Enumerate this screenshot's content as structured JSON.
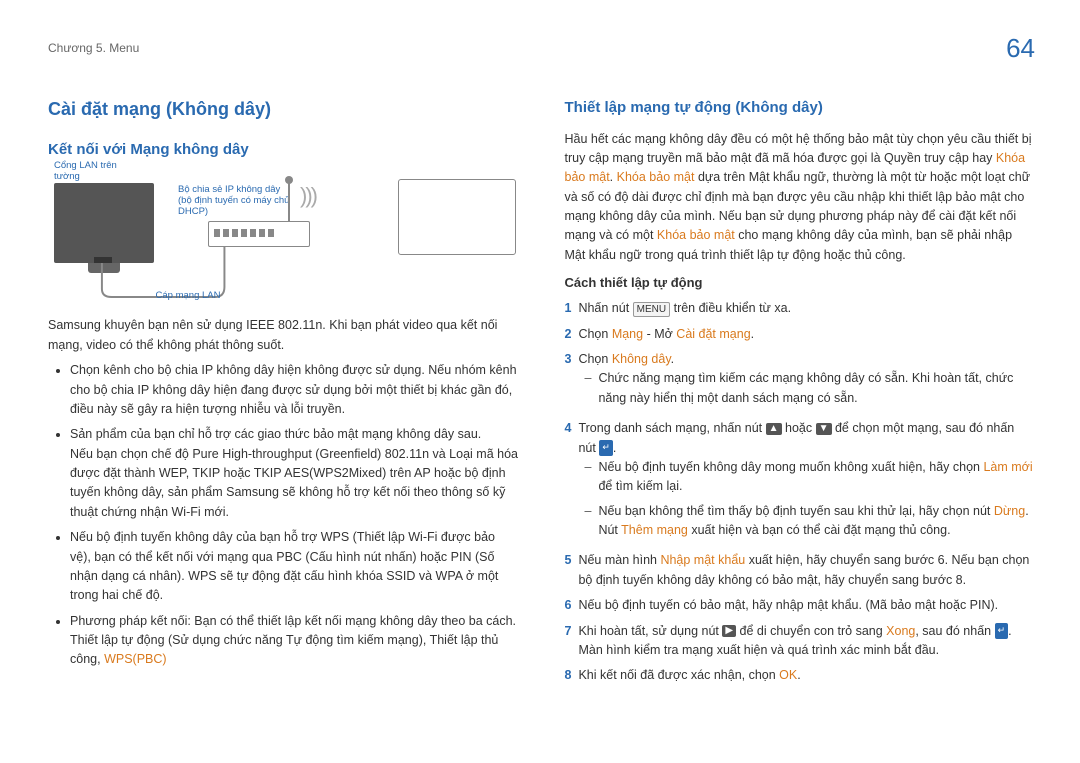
{
  "header": {
    "breadcrumb": "Chương 5. Menu",
    "page_number": "64"
  },
  "left": {
    "h2": "Cài đặt mạng (Không dây)",
    "h3": "Kết nối với Mạng không dây",
    "diagram": {
      "port_label": "Cổng LAN trên tường",
      "router_label": "Bộ chia sẻ IP không dây\n(bộ định tuyến có máy chủ DHCP)",
      "cable_label": "Cáp mạng LAN"
    },
    "para1": "Samsung khuyên bạn nên sử dụng IEEE 802.11n. Khi bạn phát video qua kết nối mạng, video có thể không phát thông suốt.",
    "bullets": [
      "Chọn kênh cho bộ chia IP không dây hiện không được sử dụng. Nếu nhóm kênh cho bộ chia IP không dây hiện đang được sử dụng bởi một thiết bị khác gần đó, điều này sẽ gây ra hiện tượng nhiễu và lỗi truyền.",
      "Sản phẩm của bạn chỉ hỗ trợ các giao thức bảo mật mạng không dây sau.\nNếu bạn chọn chế độ Pure High-throughput (Greenfield) 802.11n và Loại mã hóa được đặt thành WEP, TKIP hoặc TKIP AES(WPS2Mixed) trên AP hoặc bộ định tuyến không dây, sản phẩm Samsung sẽ không hỗ trợ kết nối theo thông số kỹ thuật chứng nhận Wi-Fi mới.",
      "Nếu bộ định tuyến không dây của bạn hỗ trợ WPS (Thiết lập Wi-Fi được bảo vệ), bạn có thể kết nối với mạng qua PBC (Cấu hình nút nhấn) hoặc PIN (Số nhận dạng cá nhân). WPS sẽ tự động đặt cấu hình khóa SSID và WPA ở một trong hai chế độ.",
      "Phương pháp kết nối: Bạn có thể thiết lập kết nối mạng không dây theo ba cách.\nThiết lập tự động (Sử dụng chức năng Tự động tìm kiếm mạng), Thiết lập thủ công, "
    ],
    "wps_label": "WPS(PBC)"
  },
  "right": {
    "h3": "Thiết lập mạng tự động (Không dây)",
    "intro_1": "Hầu hết các mạng không dây đều có một hệ thống bảo mật tùy chọn yêu cầu thiết bị truy cập mạng truyền mã bảo mật đã mã hóa được gọi là Quyền truy cập hay ",
    "term_key1": "Khóa bảo mật",
    "intro_2": ". ",
    "term_key2": "Khóa bảo mật",
    "intro_3": " dựa trên Mật khẩu ngữ, thường là một từ hoặc một loạt chữ và số có độ dài được chỉ định mà bạn được yêu cầu nhập khi thiết lập bảo mật cho mạng không dây của mình. Nếu bạn sử dụng phương pháp này để cài đặt kết nối mạng và có một ",
    "term_key3": "Khóa bảo mật",
    "intro_4": " cho mạng không dây của mình, bạn sẽ phải nhập Mật khẩu ngữ trong quá trình thiết lập tự động hoặc thủ công.",
    "h4": "Cách thiết lập tự động",
    "steps": {
      "1": {
        "pre": "Nhấn nút ",
        "chip": "MENU",
        "post": " trên điều khiển từ xa."
      },
      "2": {
        "pre": "Chọn ",
        "link1": "Mạng",
        "mid": " - Mở ",
        "link2": "Cài đặt mạng",
        "post": "."
      },
      "3": {
        "pre": "Chọn ",
        "link": "Không dây",
        "post": ".",
        "sub": "Chức năng mạng tìm kiếm các mạng không dây có sẵn. Khi hoàn tất, chức năng này hiển thị một danh sách mạng có sẵn."
      },
      "4": {
        "pre": "Trong danh sách mạng, nhấn nút ",
        "icon1": "▲",
        "mid1": " hoặc ",
        "icon2": "▼",
        "mid2": " để chọn một mạng, sau đó nhấn nút ",
        "enter": "↵",
        "post": ".",
        "sub1_pre": "Nếu bộ định tuyến không dây mong muốn không xuất hiện, hãy chọn ",
        "sub1_link": "Làm mới",
        "sub1_post": " để tìm kiếm lại.",
        "sub2_pre": "Nếu bạn không thể tìm thấy bộ định tuyến sau khi thử lại, hãy chọn nút ",
        "sub2_link1": "Dừng",
        "sub2_mid": ". Nút ",
        "sub2_link2": "Thêm mạng",
        "sub2_post": " xuất hiện và bạn có thể cài đặt mạng thủ công."
      },
      "5": {
        "pre": "Nếu màn hình ",
        "link": "Nhập mật khẩu",
        "post": " xuất hiện, hãy chuyển sang bước 6. Nếu bạn chọn bộ định tuyến không dây không có bảo mật, hãy chuyển sang bước 8."
      },
      "6": {
        "text": "Nếu bộ định tuyến có bảo mật, hãy nhập mật khẩu. (Mã bảo mật hoặc PIN)."
      },
      "7": {
        "pre": "Khi hoàn tất, sử dụng nút ",
        "icon": "▶",
        "mid": " để di chuyển con trỏ sang ",
        "link": "Xong",
        "mid2": ", sau đó nhấn ",
        "enter": "↵",
        "post": ". Màn hình kiểm tra mạng xuất hiện và quá trình xác minh bắt đầu."
      },
      "8": {
        "pre": "Khi kết nối đã được xác nhận, chọn ",
        "link": "OK",
        "post": "."
      }
    }
  }
}
